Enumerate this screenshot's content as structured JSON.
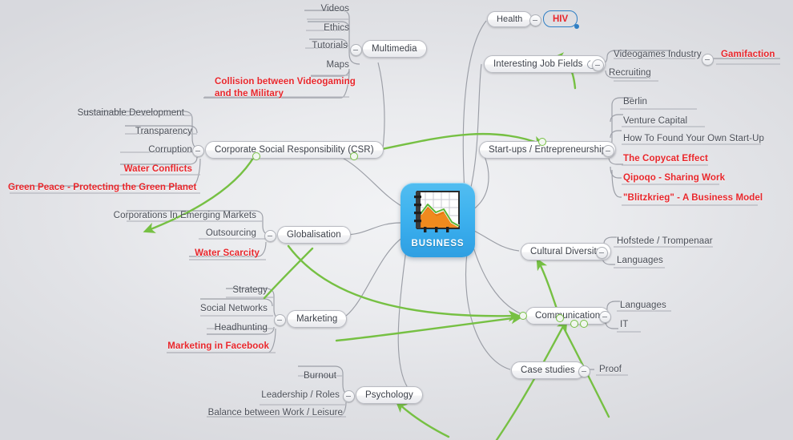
{
  "title": "BUSINESS",
  "colors": {
    "background": "#e1e2e6",
    "center_node": "#3fb3ef",
    "relationship_line": "#76c043",
    "branch_line": "#9b9ea6",
    "highlight_text": "#e8262b",
    "normal_text": "#4a4e57",
    "framed_border": "#2f7fc4"
  },
  "center": {
    "label": "BUSINESS",
    "icon": "bar-chart-icon"
  },
  "branches": [
    {
      "id": "multimedia",
      "label": "Multimedia",
      "children": [
        {
          "label": "Videos",
          "red": false
        },
        {
          "label": "Ethics",
          "red": false
        },
        {
          "label": "Tutorials",
          "red": false
        },
        {
          "label": "Maps",
          "red": false
        },
        {
          "label": "Collision between Videogaming and the Military",
          "red": true
        }
      ]
    },
    {
      "id": "csr",
      "label": "Corporate Social Responsibility (CSR)",
      "children": [
        {
          "label": "Sustainable Development",
          "red": false
        },
        {
          "label": "Transparency",
          "red": false
        },
        {
          "label": "Corruption",
          "red": false
        },
        {
          "label": "Water Conflicts",
          "red": true
        },
        {
          "label": "Green Peace - Protecting the Green Planet",
          "red": true
        }
      ]
    },
    {
      "id": "globalisation",
      "label": "Globalisation",
      "children": [
        {
          "label": "Corporations In Emerging Markets",
          "red": false
        },
        {
          "label": "Outsourcing",
          "red": false
        },
        {
          "label": "Water Scarcity",
          "red": true
        }
      ]
    },
    {
      "id": "marketing",
      "label": "Marketing",
      "children": [
        {
          "label": "Strategy",
          "red": false
        },
        {
          "label": "Social Networks",
          "red": false
        },
        {
          "label": "Headhunting",
          "red": false
        },
        {
          "label": "Marketing in Facebook",
          "red": true
        }
      ]
    },
    {
      "id": "psychology",
      "label": "Psychology",
      "children": [
        {
          "label": "Burnout",
          "red": false
        },
        {
          "label": "Leadership / Roles",
          "red": false
        },
        {
          "label": "Balance between Work / Leisure",
          "red": false
        }
      ]
    },
    {
      "id": "health",
      "label": "Health",
      "children": [
        {
          "label": "HIV",
          "red": true,
          "framed": true
        }
      ]
    },
    {
      "id": "jobfields",
      "label": "Interesting Job Fields",
      "icon": "refresh-icon",
      "children": [
        {
          "label": "Videogames Industry",
          "red": false
        },
        {
          "label": "Recruiting",
          "red": false
        },
        {
          "label": "Gamifaction",
          "red": true
        }
      ]
    },
    {
      "id": "startups",
      "label": "Start-ups / Entrepreneurship",
      "children": [
        {
          "label": "Berlin",
          "red": false
        },
        {
          "label": "Venture Capital",
          "red": false
        },
        {
          "label": "How To Found Your Own Start-Up",
          "red": false
        },
        {
          "label": "The Copycat Effect",
          "red": true
        },
        {
          "label": "Qipoqo - Sharing Work",
          "red": true
        },
        {
          "label": "\"Blitzkrieg\" - A Business Model",
          "red": true
        }
      ]
    },
    {
      "id": "cultural",
      "label": "Cultural Diversity",
      "children": [
        {
          "label": "Hofstede / Trompenaar",
          "red": false
        },
        {
          "label": "Languages",
          "red": false
        }
      ]
    },
    {
      "id": "communication",
      "label": "Communication",
      "children": [
        {
          "label": "Languages",
          "red": false
        },
        {
          "label": "IT",
          "red": false
        }
      ]
    },
    {
      "id": "casestudies",
      "label": "Case studies",
      "children": [
        {
          "label": "Proof",
          "red": false
        }
      ]
    }
  ],
  "nodes": {
    "multimedia": "Multimedia",
    "csr": "Corporate Social Responsibility (CSR)",
    "globalisation": "Globalisation",
    "marketing": "Marketing",
    "psychology": "Psychology",
    "health": "Health",
    "hiv": "HIV",
    "jobfields": "Interesting Job Fields",
    "startups": "Start-ups / Entrepreneurship",
    "cultural": "Cultural Diversity",
    "communication": "Communication",
    "casestudies": "Case studies"
  },
  "leaves": {
    "videos": "Videos",
    "ethics": "Ethics",
    "tutorials": "Tutorials",
    "maps": "Maps",
    "collision_l1": "Collision between Videogaming",
    "collision_l2": "and the Military",
    "sustainable": "Sustainable Development",
    "transparency": "Transparency",
    "corruption": "Corruption",
    "water_conflicts": "Water Conflicts",
    "green_peace": "Green Peace - Protecting the Green Planet",
    "corporations": "Corporations In Emerging Markets",
    "outsourcing": "Outsourcing",
    "water_scarcity": "Water Scarcity",
    "strategy": "Strategy",
    "social_networks": "Social Networks",
    "headhunting": "Headhunting",
    "marketing_fb": "Marketing in Facebook",
    "burnout": "Burnout",
    "leadership": "Leadership / Roles",
    "balance": "Balance between Work / Leisure",
    "videogames_industry": "Videogames Industry",
    "recruiting": "Recruiting",
    "gamifaction": "Gamifaction",
    "berlin": "Berlin",
    "venture_capital": "Venture Capital",
    "how_to_found": "How To Found Your Own Start-Up",
    "copycat": "The Copycat Effect",
    "qipoqo": "Qipoqo - Sharing Work",
    "blitzkrieg": "\"Blitzkrieg\" - A Business Model",
    "hofstede": "Hofstede / Trompenaar",
    "languages_cd": "Languages",
    "languages_com": "Languages",
    "it": "IT",
    "proof": "Proof"
  }
}
